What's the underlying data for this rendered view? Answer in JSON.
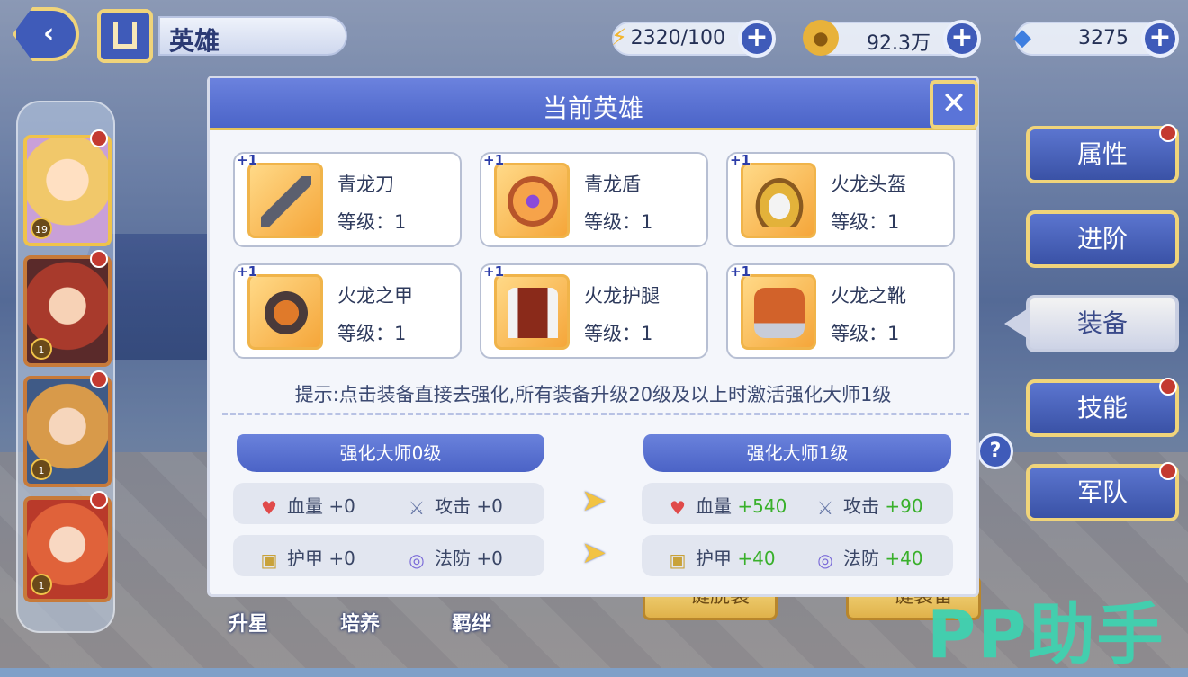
{
  "header": {
    "title": "英雄",
    "energy": "2320/100",
    "gold": "92.3万",
    "gems": "3275"
  },
  "heroes": [
    {
      "level": "19"
    },
    {
      "level": "1"
    },
    {
      "level": "1"
    },
    {
      "level": "1"
    }
  ],
  "side_tabs": [
    "属性",
    "进阶",
    "装备",
    "技能",
    "军队"
  ],
  "bottom_tabs": [
    "升星",
    "培养",
    "羁绊"
  ],
  "bottom_buttons": [
    "一键脱装",
    "一键装备"
  ],
  "watermark": "PP助手",
  "modal": {
    "title": "当前英雄",
    "equipment": [
      {
        "badge": "+1",
        "name": "青龙刀",
        "level": "等级：1"
      },
      {
        "badge": "+1",
        "name": "青龙盾",
        "level": "等级：1"
      },
      {
        "badge": "+1",
        "name": "火龙头盔",
        "level": "等级：1"
      },
      {
        "badge": "+1",
        "name": "火龙之甲",
        "level": "等级：1"
      },
      {
        "badge": "+1",
        "name": "火龙护腿",
        "level": "等级：1"
      },
      {
        "badge": "+1",
        "name": "火龙之靴",
        "level": "等级：1"
      }
    ],
    "hint": "提示:点击装备直接去强化,所有装备升级20级及以上时激活强化大师1级",
    "current": {
      "title": "强化大师0级",
      "hp_label": "血量",
      "hp": "+0",
      "atk_label": "攻击",
      "atk": "+0",
      "armor_label": "护甲",
      "armor": "+0",
      "mres_label": "法防",
      "mres": "+0"
    },
    "next": {
      "title": "强化大师1级",
      "hp_label": "血量",
      "hp": "+540",
      "atk_label": "攻击",
      "atk": "+90",
      "armor_label": "护甲",
      "armor": "+40",
      "mres_label": "法防",
      "mres": "+40"
    }
  }
}
